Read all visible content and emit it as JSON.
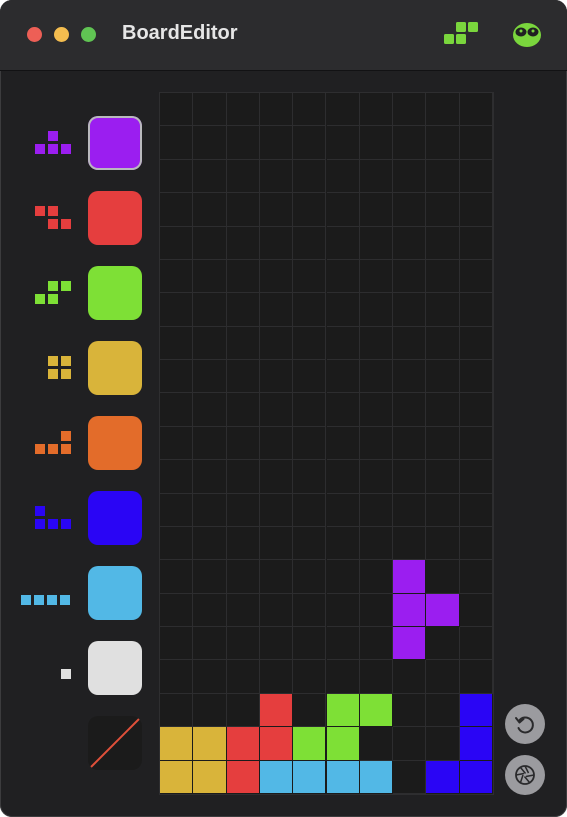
{
  "window": {
    "title": "BoardEditor",
    "header_actions": [
      {
        "name": "piece-palette-icon",
        "color": "#7ad63d"
      },
      {
        "name": "alien-face-icon",
        "color": "#7ad63d"
      }
    ]
  },
  "palette": [
    {
      "piece": "T",
      "color": "#9b1ef0",
      "selected": true
    },
    {
      "piece": "Z",
      "color": "#e53e3e",
      "selected": false
    },
    {
      "piece": "S",
      "color": "#7ee036",
      "selected": false
    },
    {
      "piece": "O",
      "color": "#d9b43a",
      "selected": false
    },
    {
      "piece": "L",
      "color": "#e36c2a",
      "selected": false
    },
    {
      "piece": "J",
      "color": "#2a05f5",
      "selected": false
    },
    {
      "piece": "I",
      "color": "#52b8e6",
      "selected": false
    },
    {
      "piece": "single-block",
      "color": "#e0e0e0",
      "selected": false
    },
    {
      "piece": "eraser",
      "color": "#1b1b1b",
      "selected": false
    }
  ],
  "board": {
    "columns": 10,
    "rows": 21,
    "empty_color": "#1b1b1b",
    "filled_cells": [
      {
        "row": 14,
        "col": 7,
        "color": "#9b1ef0"
      },
      {
        "row": 15,
        "col": 7,
        "color": "#9b1ef0"
      },
      {
        "row": 15,
        "col": 8,
        "color": "#9b1ef0"
      },
      {
        "row": 16,
        "col": 7,
        "color": "#9b1ef0"
      },
      {
        "row": 18,
        "col": 3,
        "color": "#e53e3e"
      },
      {
        "row": 18,
        "col": 5,
        "color": "#7ee036"
      },
      {
        "row": 18,
        "col": 6,
        "color": "#7ee036"
      },
      {
        "row": 18,
        "col": 9,
        "color": "#2a05f5"
      },
      {
        "row": 19,
        "col": 0,
        "color": "#d9b43a"
      },
      {
        "row": 19,
        "col": 1,
        "color": "#d9b43a"
      },
      {
        "row": 19,
        "col": 2,
        "color": "#e53e3e"
      },
      {
        "row": 19,
        "col": 3,
        "color": "#e53e3e"
      },
      {
        "row": 19,
        "col": 4,
        "color": "#7ee036"
      },
      {
        "row": 19,
        "col": 5,
        "color": "#7ee036"
      },
      {
        "row": 19,
        "col": 9,
        "color": "#2a05f5"
      },
      {
        "row": 20,
        "col": 0,
        "color": "#d9b43a"
      },
      {
        "row": 20,
        "col": 1,
        "color": "#d9b43a"
      },
      {
        "row": 20,
        "col": 2,
        "color": "#e53e3e"
      },
      {
        "row": 20,
        "col": 3,
        "color": "#52b8e6"
      },
      {
        "row": 20,
        "col": 4,
        "color": "#52b8e6"
      },
      {
        "row": 20,
        "col": 5,
        "color": "#52b8e6"
      },
      {
        "row": 20,
        "col": 6,
        "color": "#52b8e6"
      },
      {
        "row": 20,
        "col": 8,
        "color": "#2a05f5"
      },
      {
        "row": 20,
        "col": 9,
        "color": "#2a05f5"
      }
    ]
  },
  "actions": [
    {
      "name": "undo-icon"
    },
    {
      "name": "camera-shutter-icon"
    }
  ]
}
